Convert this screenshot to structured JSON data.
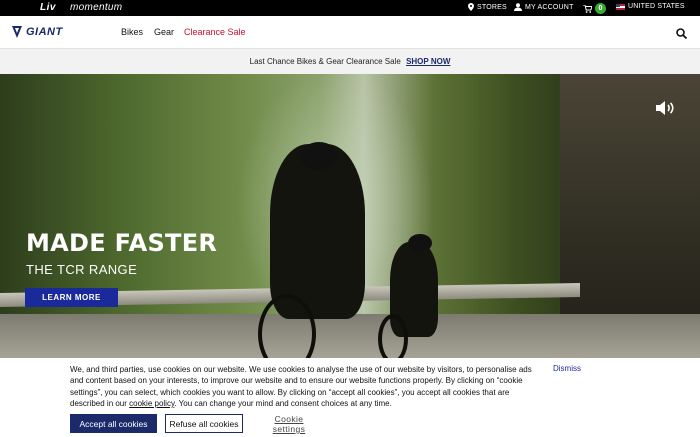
{
  "topbar": {
    "brands": [
      "Liv",
      "momentum"
    ],
    "stores_label": "STORES",
    "account_label": "MY ACCOUNT",
    "cart_count": "0",
    "country_label": "UNITED STATES",
    "icons": [
      "pin-icon",
      "user-icon",
      "cart-icon",
      "us-flag-icon"
    ]
  },
  "nav": {
    "logo": "GIANT",
    "items": [
      "Bikes",
      "Gear",
      "Clearance Sale"
    ],
    "accent_color": "#c8102e"
  },
  "promo": {
    "text": "Last Chance Bikes & Gear Clearance Sale",
    "link": "SHOP NOW"
  },
  "hero": {
    "title": "MADE FASTER",
    "subtitle": "THE TCR RANGE",
    "cta": "LEARN MORE",
    "cta_color": "#1b2a9b"
  },
  "cookie": {
    "text_before_link": "We, and third parties, use cookies on our website. We use cookies to analyse the use of our website by visitors, to personalise ads and content based on your interests, to improve our website and to ensure our website functions properly. By clicking on “cookie settings”, you can select, which cookies you want to allow. By clicking on “accept all cookies”, you accept all cookies that are described in our",
    "link_text": "cookie policy",
    "text_after_link": ". You can change your mind and consent choices at any time.",
    "dismiss": "Dismiss",
    "accept": "Accept all cookies",
    "reject": "Refuse all cookies",
    "settings": "Cookie settings"
  }
}
